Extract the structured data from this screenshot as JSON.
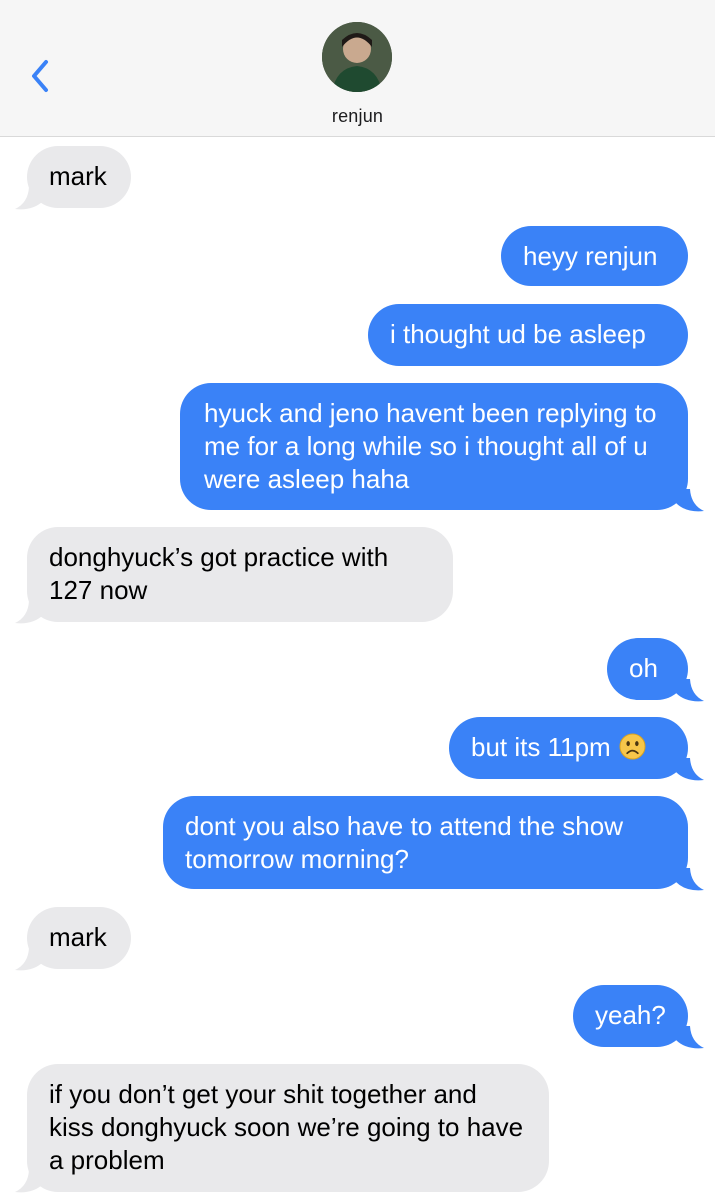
{
  "header": {
    "back_icon": "chevron-left-icon",
    "contact_name": "renjun",
    "accent_color": "#3a82f7"
  },
  "messages": [
    {
      "sender": "them",
      "text": "mark"
    },
    {
      "sender": "me",
      "text": "heyy renjun"
    },
    {
      "sender": "me",
      "text": "i thought ud be asleep"
    },
    {
      "sender": "me",
      "text": "hyuck and jeno havent been replying to me for a long while so i thought all of u were asleep haha"
    },
    {
      "sender": "them",
      "text": "donghyuck’s got practice with 127 now"
    },
    {
      "sender": "me",
      "text": "oh"
    },
    {
      "sender": "me",
      "text": "but its 11pm",
      "emoji": "frowning-face"
    },
    {
      "sender": "me",
      "text": "dont you also have to attend the show tomorrow morning?"
    },
    {
      "sender": "them",
      "text": "mark"
    },
    {
      "sender": "me",
      "text": "yeah?"
    },
    {
      "sender": "them",
      "text": "if you don’t get your shit together and kiss donghyuck soon we’re going to have a problem"
    }
  ],
  "colors": {
    "incoming_bubble": "#e9e9eb",
    "outgoing_bubble": "#3a82f7"
  }
}
